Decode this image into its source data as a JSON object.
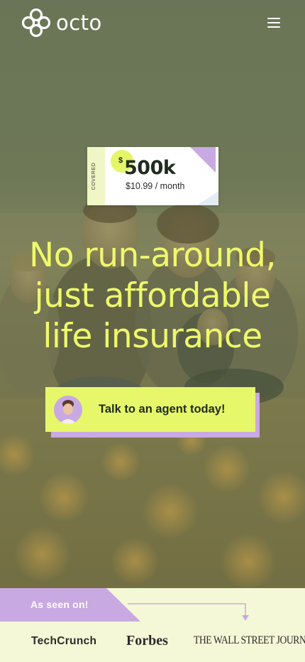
{
  "header": {
    "brand_name": "octo",
    "logo_icon": "octo-logo-icon",
    "menu_icon": "hamburger-menu-icon"
  },
  "coverage_card": {
    "covered_label": "COVERED",
    "currency": "$",
    "amount": "500k",
    "price": "$10.99 / month"
  },
  "hero": {
    "headline_lines": [
      "No run-around,",
      "just affordable",
      "life insurance"
    ]
  },
  "cta": {
    "label": "Talk to an agent today!",
    "avatar_icon": "agent-avatar"
  },
  "press": {
    "label": "As seen on!",
    "outlets": [
      "TechCrunch",
      "Forbes",
      "THE WALL STREET JOURNAL."
    ]
  },
  "colors": {
    "accent_yellow": "#e7f76a",
    "headline_yellow": "#eef96b",
    "accent_purple": "#c9a9e2",
    "press_background": "#f4f8d6"
  }
}
